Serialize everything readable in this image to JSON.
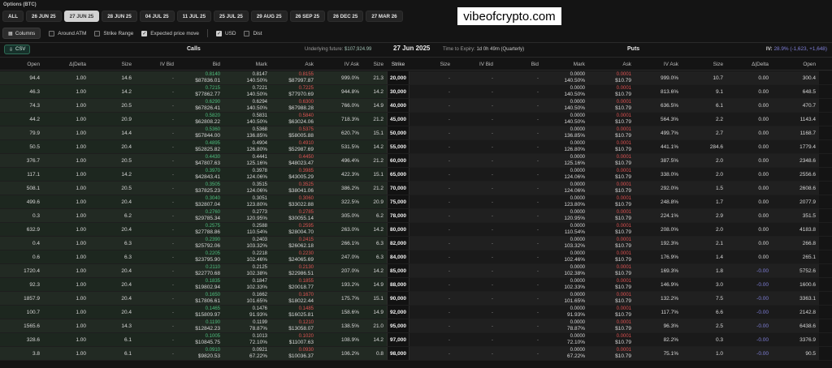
{
  "title": "Options (BTC)",
  "watermark": "vibeofcrypto.com",
  "expiries": [
    "ALL",
    "26 JUN 25",
    "27 JUN 25",
    "28 JUN 25",
    "04 JUL 25",
    "11 JUL 25",
    "25 JUL 25",
    "29 AUG 25",
    "26 SEP 25",
    "26 DEC 25",
    "27 MAR 26"
  ],
  "active_expiry": "27 JUN 25",
  "options_bar": {
    "columns_label": "Columns",
    "around_atm": "Around ATM",
    "strike_range": "Strike Range",
    "expected_move": "Expected price move",
    "usd": "USD",
    "dist": "Dist"
  },
  "info": {
    "csv_label": "CSV",
    "calls_label": "Calls",
    "puts_label": "Puts",
    "underlying_label": "Underlying future:",
    "underlying_value": "$107,924.99",
    "date": "27 Jun 2025",
    "tte_label": "Time to Expiry:",
    "tte_value": "1d 0h 49m (Quarterly)",
    "iv_label": "IV:",
    "iv_value": "28.9% (-1,623, +1,648)"
  },
  "columns": {
    "calls": [
      "Open",
      "Δ|Delta",
      "Size",
      "IV Bid",
      "Bid",
      "Mark",
      "Ask",
      "IV Ask",
      "Size"
    ],
    "strike": "Strike",
    "puts": [
      "Size",
      "IV Bid",
      "Bid",
      "Mark",
      "Ask",
      "IV Ask",
      "Size",
      "Δ|Delta",
      "Open"
    ]
  },
  "rows": [
    {
      "c_open": "94.4",
      "c_delta": "1.00",
      "c_size": "14.6",
      "c_ivbid": "-",
      "c_bid": [
        "0.8140",
        "$87836.01"
      ],
      "c_mark": [
        "0.8147",
        "140.50%"
      ],
      "c_ask": [
        "0.8155",
        "$87997.87"
      ],
      "c_ivask": "999.0%",
      "c_size2": "21.3",
      "strike": "20,000",
      "p_size": "-",
      "p_ivbid": "-",
      "p_bid": "-",
      "p_mark": [
        "0.0000",
        "140.50%"
      ],
      "p_ask": [
        "0.0001",
        "$10.79"
      ],
      "p_ivask": "999.0%",
      "p_size2": "10.7",
      "p_delta": "0.00",
      "p_open": "300.4"
    },
    {
      "c_open": "46.3",
      "c_delta": "1.00",
      "c_size": "14.2",
      "c_ivbid": "-",
      "c_bid": [
        "0.7215",
        "$77862.77"
      ],
      "c_mark": [
        "0.7221",
        "140.50%"
      ],
      "c_ask": [
        "0.7225",
        "$77970.69"
      ],
      "c_ivask": "944.8%",
      "c_size2": "14.2",
      "strike": "30,000",
      "p_size": "-",
      "p_ivbid": "-",
      "p_bid": "-",
      "p_mark": [
        "0.0000",
        "140.50%"
      ],
      "p_ask": [
        "0.0001",
        "$10.79"
      ],
      "p_ivask": "813.6%",
      "p_size2": "9.1",
      "p_delta": "0.00",
      "p_open": "648.5"
    },
    {
      "c_open": "74.3",
      "c_delta": "1.00",
      "c_size": "20.5",
      "c_ivbid": "-",
      "c_bid": [
        "0.6290",
        "$67826.41"
      ],
      "c_mark": [
        "0.6294",
        "140.50%"
      ],
      "c_ask": [
        "0.6300",
        "$67988.28"
      ],
      "c_ivask": "766.0%",
      "c_size2": "14.9",
      "strike": "40,000",
      "p_size": "-",
      "p_ivbid": "-",
      "p_bid": "-",
      "p_mark": [
        "0.0000",
        "140.50%"
      ],
      "p_ask": [
        "0.0001",
        "$10.79"
      ],
      "p_ivask": "636.5%",
      "p_size2": "6.1",
      "p_delta": "0.00",
      "p_open": "470.7"
    },
    {
      "c_open": "44.2",
      "c_delta": "1.00",
      "c_size": "20.9",
      "c_ivbid": "-",
      "c_bid": [
        "0.5820",
        "$62808.22"
      ],
      "c_mark": [
        "0.5831",
        "140.50%"
      ],
      "c_ask": [
        "0.5840",
        "$63024.06"
      ],
      "c_ivask": "718.3%",
      "c_size2": "21.2",
      "strike": "45,000",
      "p_size": "-",
      "p_ivbid": "-",
      "p_bid": "-",
      "p_mark": [
        "0.0000",
        "140.50%"
      ],
      "p_ask": [
        "0.0001",
        "$10.79"
      ],
      "p_ivask": "564.3%",
      "p_size2": "2.2",
      "p_delta": "0.00",
      "p_open": "1143.4"
    },
    {
      "c_open": "79.9",
      "c_delta": "1.00",
      "c_size": "14.4",
      "c_ivbid": "-",
      "c_bid": [
        "0.5360",
        "$57844.00"
      ],
      "c_mark": [
        "0.5368",
        "136.85%"
      ],
      "c_ask": [
        "0.5375",
        "$58005.88"
      ],
      "c_ivask": "620.7%",
      "c_size2": "15.1",
      "strike": "50,000",
      "p_size": "-",
      "p_ivbid": "-",
      "p_bid": "-",
      "p_mark": [
        "0.0000",
        "136.85%"
      ],
      "p_ask": [
        "0.0001",
        "$10.79"
      ],
      "p_ivask": "499.7%",
      "p_size2": "2.7",
      "p_delta": "0.00",
      "p_open": "1168.7"
    },
    {
      "c_open": "50.5",
      "c_delta": "1.00",
      "c_size": "20.4",
      "c_ivbid": "-",
      "c_bid": [
        "0.4895",
        "$52825.82"
      ],
      "c_mark": [
        "0.4904",
        "126.80%"
      ],
      "c_ask": [
        "0.4910",
        "$52987.69"
      ],
      "c_ivask": "531.5%",
      "c_size2": "14.2",
      "strike": "55,000",
      "p_size": "-",
      "p_ivbid": "-",
      "p_bid": "-",
      "p_mark": [
        "0.0000",
        "126.80%"
      ],
      "p_ask": [
        "0.0001",
        "$10.79"
      ],
      "p_ivask": "441.1%",
      "p_size2": "284.6",
      "p_delta": "0.00",
      "p_open": "1779.4"
    },
    {
      "c_open": "376.7",
      "c_delta": "1.00",
      "c_size": "20.5",
      "c_ivbid": "-",
      "c_bid": [
        "0.4430",
        "$47807.63"
      ],
      "c_mark": [
        "0.4441",
        "125.16%"
      ],
      "c_ask": [
        "0.4450",
        "$48023.47"
      ],
      "c_ivask": "496.4%",
      "c_size2": "21.2",
      "strike": "60,000",
      "p_size": "-",
      "p_ivbid": "-",
      "p_bid": "-",
      "p_mark": [
        "0.0000",
        "125.16%"
      ],
      "p_ask": [
        "0.0001",
        "$10.79"
      ],
      "p_ivask": "387.5%",
      "p_size2": "2.0",
      "p_delta": "0.00",
      "p_open": "2348.6"
    },
    {
      "c_open": "117.1",
      "c_delta": "1.00",
      "c_size": "14.2",
      "c_ivbid": "-",
      "c_bid": [
        "0.3970",
        "$42843.41"
      ],
      "c_mark": [
        "0.3978",
        "124.06%"
      ],
      "c_ask": [
        "0.3985",
        "$43005.29"
      ],
      "c_ivask": "422.3%",
      "c_size2": "15.1",
      "strike": "65,000",
      "p_size": "-",
      "p_ivbid": "-",
      "p_bid": "-",
      "p_mark": [
        "0.0000",
        "124.06%"
      ],
      "p_ask": [
        "0.0001",
        "$10.79"
      ],
      "p_ivask": "338.0%",
      "p_size2": "2.0",
      "p_delta": "0.00",
      "p_open": "2556.6"
    },
    {
      "c_open": "508.1",
      "c_delta": "1.00",
      "c_size": "20.5",
      "c_ivbid": "-",
      "c_bid": [
        "0.3505",
        "$37825.23"
      ],
      "c_mark": [
        "0.3515",
        "124.06%"
      ],
      "c_ask": [
        "0.3525",
        "$38041.06"
      ],
      "c_ivask": "386.2%",
      "c_size2": "21.2",
      "strike": "70,000",
      "p_size": "-",
      "p_ivbid": "-",
      "p_bid": "-",
      "p_mark": [
        "0.0000",
        "124.06%"
      ],
      "p_ask": [
        "0.0001",
        "$10.79"
      ],
      "p_ivask": "292.0%",
      "p_size2": "1.5",
      "p_delta": "0.00",
      "p_open": "2608.6"
    },
    {
      "c_open": "499.6",
      "c_delta": "1.00",
      "c_size": "20.4",
      "c_ivbid": "-",
      "c_bid": [
        "0.3040",
        "$32807.04"
      ],
      "c_mark": [
        "0.3051",
        "123.80%"
      ],
      "c_ask": [
        "0.3060",
        "$33022.88"
      ],
      "c_ivask": "322.5%",
      "c_size2": "20.9",
      "strike": "75,000",
      "p_size": "-",
      "p_ivbid": "-",
      "p_bid": "-",
      "p_mark": [
        "0.0000",
        "123.80%"
      ],
      "p_ask": [
        "0.0001",
        "$10.79"
      ],
      "p_ivask": "248.8%",
      "p_size2": "1.7",
      "p_delta": "0.00",
      "p_open": "2077.9"
    },
    {
      "c_open": "0.3",
      "c_delta": "1.00",
      "c_size": "6.2",
      "c_ivbid": "-",
      "c_bid": [
        "0.2760",
        "$29785.34"
      ],
      "c_mark": [
        "0.2773",
        "120.95%"
      ],
      "c_ask": [
        "0.2785",
        "$30055.14"
      ],
      "c_ivask": "305.0%",
      "c_size2": "6.2",
      "strike": "78,000",
      "p_size": "-",
      "p_ivbid": "-",
      "p_bid": "-",
      "p_mark": [
        "0.0000",
        "120.95%"
      ],
      "p_ask": [
        "0.0001",
        "$10.79"
      ],
      "p_ivask": "224.1%",
      "p_size2": "2.9",
      "p_delta": "0.00",
      "p_open": "351.5"
    },
    {
      "c_open": "632.9",
      "c_delta": "1.00",
      "c_size": "20.4",
      "c_ivbid": "-",
      "c_bid": [
        "0.2575",
        "$27788.86"
      ],
      "c_mark": [
        "0.2588",
        "110.54%"
      ],
      "c_ask": [
        "0.2595",
        "$28004.70"
      ],
      "c_ivask": "263.0%",
      "c_size2": "14.2",
      "strike": "80,000",
      "p_size": "-",
      "p_ivbid": "-",
      "p_bid": "-",
      "p_mark": [
        "0.0000",
        "110.54%"
      ],
      "p_ask": [
        "0.0001",
        "$10.79"
      ],
      "p_ivask": "208.0%",
      "p_size2": "2.0",
      "p_delta": "0.00",
      "p_open": "4183.8"
    },
    {
      "c_open": "0.4",
      "c_delta": "1.00",
      "c_size": "6.3",
      "c_ivbid": "-",
      "c_bid": [
        "0.2390",
        "$25792.06"
      ],
      "c_mark": [
        "0.2403",
        "103.32%"
      ],
      "c_ask": [
        "0.2415",
        "$26062.18"
      ],
      "c_ivask": "266.1%",
      "c_size2": "6.3",
      "strike": "82,000",
      "p_size": "-",
      "p_ivbid": "-",
      "p_bid": "-",
      "p_mark": [
        "0.0000",
        "103.32%"
      ],
      "p_ask": [
        "0.0001",
        "$10.79"
      ],
      "p_ivask": "192.3%",
      "p_size2": "2.1",
      "p_delta": "0.00",
      "p_open": "266.8"
    },
    {
      "c_open": "0.6",
      "c_delta": "1.00",
      "c_size": "6.3",
      "c_ivbid": "-",
      "c_bid": [
        "0.2205",
        "$23795.90"
      ],
      "c_mark": [
        "0.2218",
        "102.46%"
      ],
      "c_ask": [
        "0.2230",
        "$24065.69"
      ],
      "c_ivask": "247.0%",
      "c_size2": "6.3",
      "strike": "84,000",
      "p_size": "-",
      "p_ivbid": "-",
      "p_bid": "-",
      "p_mark": [
        "0.0000",
        "102.46%"
      ],
      "p_ask": [
        "0.0001",
        "$10.79"
      ],
      "p_ivask": "176.9%",
      "p_size2": "1.4",
      "p_delta": "0.00",
      "p_open": "265.1"
    },
    {
      "c_open": "1720.4",
      "c_delta": "1.00",
      "c_size": "20.4",
      "c_ivbid": "-",
      "c_bid": [
        "0.2110",
        "$22770.68"
      ],
      "c_mark": [
        "0.2125",
        "102.38%"
      ],
      "c_ask": [
        "0.2130",
        "$22986.51"
      ],
      "c_ivask": "207.0%",
      "c_size2": "14.2",
      "strike": "85,000",
      "p_size": "-",
      "p_ivbid": "-",
      "p_bid": "-",
      "p_mark": [
        "0.0000",
        "102.38%"
      ],
      "p_ask": [
        "0.0001",
        "$10.79"
      ],
      "p_ivask": "169.3%",
      "p_size2": "1.8",
      "p_delta": "-0.00",
      "p_open": "5752.6"
    },
    {
      "c_open": "92.3",
      "c_delta": "1.00",
      "c_size": "20.4",
      "c_ivbid": "-",
      "c_bid": [
        "0.1835",
        "$19802.94"
      ],
      "c_mark": [
        "0.1847",
        "102.33%"
      ],
      "c_ask": [
        "0.1855",
        "$20018.77"
      ],
      "c_ivask": "193.2%",
      "c_size2": "14.9",
      "strike": "88,000",
      "p_size": "-",
      "p_ivbid": "-",
      "p_bid": "-",
      "p_mark": [
        "0.0000",
        "102.33%"
      ],
      "p_ask": [
        "0.0001",
        "$10.79"
      ],
      "p_ivask": "146.9%",
      "p_size2": "3.0",
      "p_delta": "-0.00",
      "p_open": "1600.6"
    },
    {
      "c_open": "1857.9",
      "c_delta": "1.00",
      "c_size": "20.4",
      "c_ivbid": "-",
      "c_bid": [
        "0.1650",
        "$17806.61"
      ],
      "c_mark": [
        "0.1662",
        "101.65%"
      ],
      "c_ask": [
        "0.1670",
        "$18022.44"
      ],
      "c_ivask": "175.7%",
      "c_size2": "15.1",
      "strike": "90,000",
      "p_size": "-",
      "p_ivbid": "-",
      "p_bid": "-",
      "p_mark": [
        "0.0000",
        "101.65%"
      ],
      "p_ask": [
        "0.0001",
        "$10.79"
      ],
      "p_ivask": "132.2%",
      "p_size2": "7.5",
      "p_delta": "-0.00",
      "p_open": "3363.1"
    },
    {
      "c_open": "100.7",
      "c_delta": "1.00",
      "c_size": "20.4",
      "c_ivbid": "-",
      "c_bid": [
        "0.1465",
        "$15809.97"
      ],
      "c_mark": [
        "0.1476",
        "91.93%"
      ],
      "c_ask": [
        "0.1485",
        "$16025.81"
      ],
      "c_ivask": "158.6%",
      "c_size2": "14.9",
      "strike": "92,000",
      "p_size": "-",
      "p_ivbid": "-",
      "p_bid": "-",
      "p_mark": [
        "0.0000",
        "91.93%"
      ],
      "p_ask": [
        "0.0001",
        "$10.79"
      ],
      "p_ivask": "117.7%",
      "p_size2": "6.6",
      "p_delta": "-0.00",
      "p_open": "2142.8"
    },
    {
      "c_open": "1565.6",
      "c_delta": "1.00",
      "c_size": "14.3",
      "c_ivbid": "-",
      "c_bid": [
        "0.1190",
        "$12842.23"
      ],
      "c_mark": [
        "0.1199",
        "78.87%"
      ],
      "c_ask": [
        "0.1210",
        "$13058.07"
      ],
      "c_ivask": "138.5%",
      "c_size2": "21.0",
      "strike": "95,000",
      "p_size": "-",
      "p_ivbid": "-",
      "p_bid": "-",
      "p_mark": [
        "0.0000",
        "78.87%"
      ],
      "p_ask": [
        "0.0001",
        "$10.79"
      ],
      "p_ivask": "96.3%",
      "p_size2": "2.5",
      "p_delta": "-0.00",
      "p_open": "6438.6"
    },
    {
      "c_open": "328.6",
      "c_delta": "1.00",
      "c_size": "6.1",
      "c_ivbid": "-",
      "c_bid": [
        "0.1005",
        "$10845.75"
      ],
      "c_mark": [
        "0.1013",
        "72.10%"
      ],
      "c_ask": [
        "0.1020",
        "$11007.63"
      ],
      "c_ivask": "108.9%",
      "c_size2": "14.2",
      "strike": "97,000",
      "p_size": "-",
      "p_ivbid": "-",
      "p_bid": "-",
      "p_mark": [
        "0.0000",
        "72.10%"
      ],
      "p_ask": [
        "0.0001",
        "$10.79"
      ],
      "p_ivask": "82.2%",
      "p_size2": "0.3",
      "p_delta": "-0.00",
      "p_open": "3376.9"
    },
    {
      "c_open": "3.8",
      "c_delta": "1.00",
      "c_size": "6.1",
      "c_ivbid": "-",
      "c_bid": [
        "0.0910",
        "$9820.53"
      ],
      "c_mark": [
        "0.0921",
        "67.22%"
      ],
      "c_ask": [
        "0.0930",
        "$10036.37"
      ],
      "c_ivask": "106.2%",
      "c_size2": "0.8",
      "strike": "98,000",
      "p_size": "-",
      "p_ivbid": "-",
      "p_bid": "-",
      "p_mark": [
        "0.0000",
        "67.22%"
      ],
      "p_ask": [
        "0.0001",
        "$10.79"
      ],
      "p_ivask": "75.1%",
      "p_size2": "1.0",
      "p_delta": "-0.00",
      "p_open": "90.5"
    }
  ],
  "colors": {
    "call_bid": "#4fbf7f",
    "ask": "#e05252",
    "iv_highlight": "#7f7fd8",
    "accent": "#2f6d56"
  }
}
